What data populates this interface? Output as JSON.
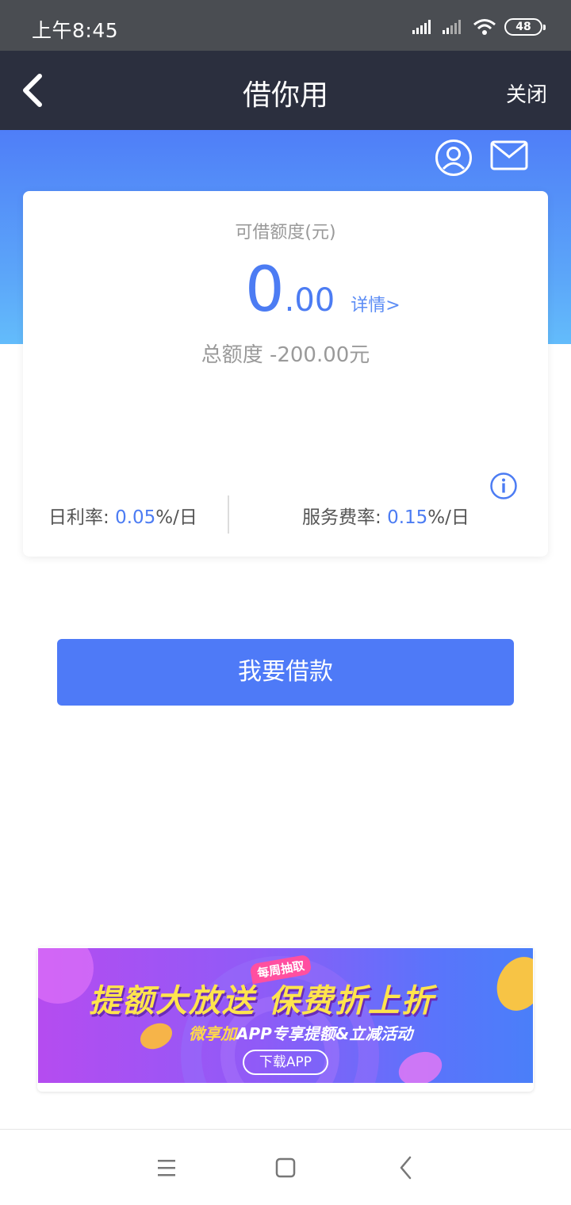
{
  "status_bar": {
    "time": "上午8:45",
    "battery": "48"
  },
  "nav": {
    "title": "借你用",
    "close_label": "关闭"
  },
  "card": {
    "label": "可借额度(元)",
    "amount_int": "0",
    "amount_dec": ".00",
    "detail_link": "详情>",
    "total_quota": "总额度 -200.00元",
    "daily_rate_label": "日利率:",
    "daily_rate_value": "0.05",
    "daily_rate_unit": "%/日",
    "service_rate_label": "服务费率:",
    "service_rate_value": "0.15",
    "service_rate_unit": "%/日"
  },
  "borrow_button": "我要借款",
  "banner": {
    "tag": "每周抽取",
    "headline": "提额大放送  保费折上折",
    "sub_highlight": "微享加",
    "sub_text": "APP专享提额&立减活动",
    "button": "下载APP"
  },
  "colors": {
    "accent": "#4e7af7",
    "nav_bg": "#2b2f3e",
    "status_bg": "#4a4d52"
  }
}
